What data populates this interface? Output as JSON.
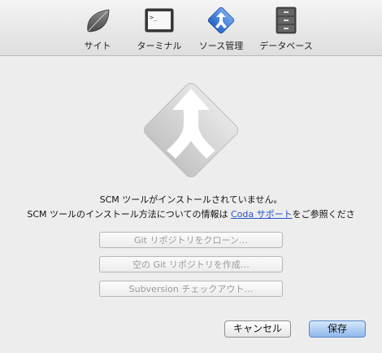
{
  "toolbar": {
    "items": [
      {
        "label": "サイト",
        "icon": "leaf-icon"
      },
      {
        "label": "ターミナル",
        "icon": "terminal-icon"
      },
      {
        "label": "ソース管理",
        "icon": "merge-arrow-icon"
      },
      {
        "label": "データベース",
        "icon": "database-icon"
      }
    ],
    "selected": "ソース管理"
  },
  "main": {
    "message_line1": "SCM ツールがインストールされていません。",
    "message_line2_prefix": "SCM ツールのインストール方法についての情報は ",
    "message_link": "Coda サポート",
    "message_line2_suffix": "をご参照くださ",
    "actions": [
      {
        "label": "Git リポジトリをクローン…"
      },
      {
        "label": "空の Git リポジトリを作成…"
      },
      {
        "label": "Subversion チェックアウト…"
      }
    ]
  },
  "footer": {
    "cancel_label": "キャンセル",
    "save_label": "保存"
  },
  "colors": {
    "accent": "#3c7fd8",
    "link": "#2850c8",
    "disabled_text": "#9a9a9a"
  }
}
